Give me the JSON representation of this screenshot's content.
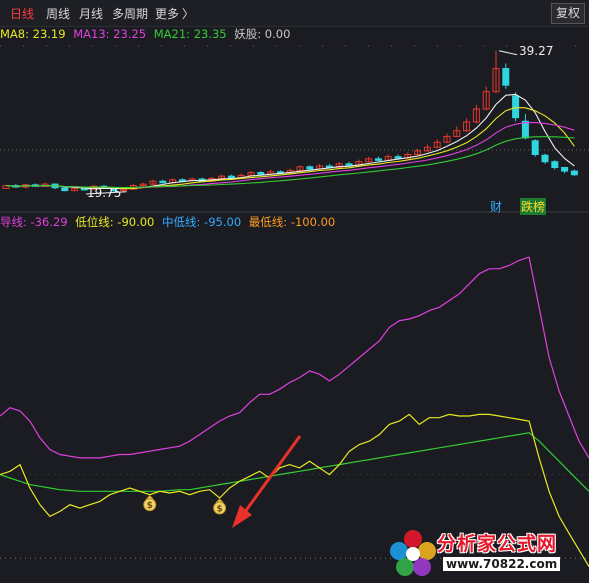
{
  "toolbar": {
    "tabs": [
      "日线",
      "周线",
      "月线",
      "多周期",
      "更多"
    ],
    "more_arrow": "〉",
    "fuquan_label": "复权"
  },
  "ma_legend": [
    {
      "text": "MA8: 23.19",
      "color": "#e8e822"
    },
    {
      "text": "MA13: 23.25",
      "color": "#e040e0"
    },
    {
      "text": "MA21: 23.35",
      "color": "#33cc33"
    },
    {
      "text": "妖股: 0.00",
      "color": "#c8c8c8"
    }
  ],
  "price_chart": {
    "high_label": "39.27",
    "low_label": "19.75",
    "badge_cai": "财",
    "badge_diebang": "跌榜",
    "candles": [
      [
        20.2,
        20.6,
        20.5,
        20.7
      ],
      [
        20.6,
        20.4,
        20.3,
        20.8
      ],
      [
        20.4,
        20.7,
        20.2,
        20.8
      ],
      [
        20.7,
        20.5,
        20.4,
        20.9
      ],
      [
        20.5,
        20.8,
        20.4,
        21.0
      ],
      [
        20.8,
        20.3,
        20.1,
        20.9
      ],
      [
        20.3,
        19.9,
        19.8,
        20.5
      ],
      [
        19.9,
        20.2,
        19.8,
        20.4
      ],
      [
        20.2,
        20.1,
        20.0,
        20.4
      ],
      [
        20.1,
        20.5,
        20.0,
        20.7
      ],
      [
        20.5,
        20.3,
        20.2,
        20.7
      ],
      [
        20.3,
        19.9,
        19.7,
        20.4
      ],
      [
        19.9,
        20.1,
        19.75,
        20.3
      ],
      [
        20.1,
        20.6,
        20.0,
        20.8
      ],
      [
        20.6,
        20.8,
        20.5,
        21.0
      ],
      [
        20.8,
        21.2,
        20.7,
        21.4
      ],
      [
        21.2,
        21.0,
        20.9,
        21.4
      ],
      [
        21.0,
        21.4,
        20.9,
        21.6
      ],
      [
        21.4,
        21.3,
        21.1,
        21.6
      ],
      [
        21.3,
        21.5,
        21.2,
        21.7
      ],
      [
        21.5,
        21.2,
        21.1,
        21.7
      ],
      [
        21.2,
        21.6,
        21.1,
        21.8
      ],
      [
        21.6,
        21.9,
        21.5,
        22.1
      ],
      [
        21.9,
        21.7,
        21.6,
        22.1
      ],
      [
        21.7,
        22.0,
        21.6,
        22.3
      ],
      [
        22.0,
        22.4,
        21.9,
        22.6
      ],
      [
        22.4,
        22.2,
        22.0,
        22.6
      ],
      [
        22.2,
        22.5,
        22.1,
        22.8
      ],
      [
        22.5,
        22.3,
        22.2,
        22.7
      ],
      [
        22.3,
        22.7,
        22.2,
        22.9
      ],
      [
        22.7,
        23.2,
        22.6,
        23.4
      ],
      [
        23.2,
        22.9,
        22.8,
        23.4
      ],
      [
        22.9,
        23.3,
        22.8,
        23.6
      ],
      [
        23.3,
        23.1,
        23.0,
        23.6
      ],
      [
        23.1,
        23.6,
        23.0,
        23.9
      ],
      [
        23.6,
        23.4,
        23.3,
        23.9
      ],
      [
        23.4,
        23.9,
        23.3,
        24.2
      ],
      [
        23.9,
        24.3,
        23.8,
        24.6
      ],
      [
        24.3,
        24.1,
        23.9,
        24.6
      ],
      [
        24.1,
        24.6,
        24.0,
        24.9
      ],
      [
        24.6,
        24.4,
        24.2,
        24.9
      ],
      [
        24.4,
        24.9,
        24.3,
        25.2
      ],
      [
        24.9,
        25.4,
        24.8,
        25.7
      ],
      [
        25.4,
        25.9,
        25.3,
        26.3
      ],
      [
        25.9,
        26.6,
        25.8,
        27.0
      ],
      [
        26.6,
        27.4,
        26.5,
        27.8
      ],
      [
        27.4,
        28.2,
        27.3,
        28.8
      ],
      [
        28.2,
        29.4,
        28.0,
        29.9
      ],
      [
        29.4,
        31.2,
        29.2,
        31.8
      ],
      [
        31.2,
        33.6,
        31.0,
        34.3
      ],
      [
        33.6,
        36.8,
        33.4,
        39.27
      ],
      [
        36.8,
        34.5,
        34.0,
        37.5
      ],
      [
        33.0,
        30.0,
        29.5,
        33.5
      ],
      [
        29.5,
        27.2,
        27.0,
        30.5
      ],
      [
        26.8,
        24.9,
        24.6,
        27.0
      ],
      [
        24.8,
        23.9,
        23.6,
        25.0
      ],
      [
        23.9,
        23.1,
        22.8,
        24.1
      ],
      [
        23.1,
        22.6,
        22.3,
        23.2
      ],
      [
        22.6,
        22.1,
        21.9,
        22.8
      ]
    ]
  },
  "indicator_legend": [
    {
      "text": "导线: -36.29",
      "color": "#e040e0"
    },
    {
      "text": "低位线: -90.00",
      "color": "#e8e822"
    },
    {
      "text": "中低线: -95.00",
      "color": "#33aaff"
    },
    {
      "text": "最低线: -100.00",
      "color": "#ff9922"
    }
  ],
  "indicator_chart": {
    "magenta": [
      -55,
      -50,
      -52,
      -58,
      -68,
      -75,
      -78,
      -79,
      -80,
      -80,
      -80,
      -79,
      -78,
      -78,
      -77,
      -76,
      -75,
      -74,
      -73,
      -70,
      -66,
      -62,
      -58,
      -55,
      -53,
      -47,
      -42,
      -42,
      -39,
      -35,
      -32,
      -28,
      -30,
      -34,
      -30,
      -25,
      -20,
      -15,
      -10,
      -2,
      2,
      3,
      5,
      8,
      10,
      14,
      18,
      24,
      30,
      33,
      33,
      35,
      38,
      40,
      10,
      -20,
      -40,
      -55,
      -70,
      -80
    ],
    "yellow": [
      -90,
      -88,
      -84,
      -98,
      -108,
      -115,
      -112,
      -108,
      -110,
      -108,
      -106,
      -102,
      -100,
      -98,
      -100,
      -102,
      -100,
      -101,
      -100,
      -102,
      -100,
      -99,
      -104,
      -98,
      -94,
      -91,
      -88,
      -92,
      -86,
      -84,
      -86,
      -82,
      -86,
      -90,
      -84,
      -76,
      -72,
      -70,
      -66,
      -60,
      -58,
      -54,
      -60,
      -56,
      -56,
      -54,
      -55,
      -55,
      -54,
      -54,
      -55,
      -56,
      -57,
      -58,
      -80,
      -100,
      -115,
      -125,
      -135,
      -145
    ],
    "green": [
      -90,
      -92,
      -94,
      -96,
      -97,
      -98,
      -99,
      -99.5,
      -100,
      -100,
      -100,
      -100,
      -100,
      -100,
      -100,
      -100,
      -100,
      -99.5,
      -99,
      -99,
      -98,
      -97,
      -96,
      -95,
      -94,
      -93,
      -92,
      -91,
      -90,
      -89,
      -88,
      -87,
      -86,
      -85,
      -84,
      -83,
      -82,
      -81,
      -80,
      -79,
      -78,
      -77,
      -76,
      -75,
      -74,
      -73,
      -72,
      -71,
      -70,
      -69,
      -68,
      -67,
      -66,
      -65,
      -70,
      -76,
      -82,
      -88,
      -94,
      -100
    ],
    "bag_symbol": "$"
  },
  "watermark": {
    "title": "分析家公式网",
    "url": "www.70822.com"
  },
  "colors": {
    "up": "#e8372b",
    "down": "#2fd6e0",
    "ma8": "#e8e822",
    "ma13": "#e040e0",
    "ma21": "#33cc33",
    "ma_white": "#eeeeee",
    "annotation_arrow": "#e8312b"
  }
}
